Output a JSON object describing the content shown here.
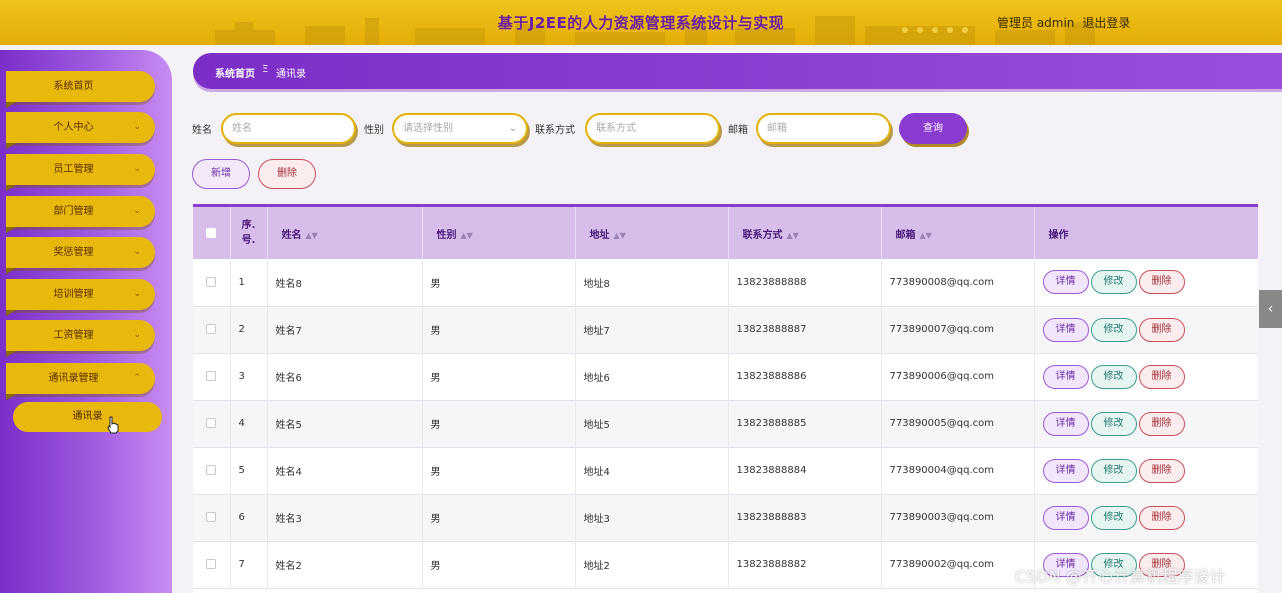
{
  "header": {
    "title": "基于J2EE的人力资源管理系统设计与实现",
    "user_label": "管理员 admin",
    "logout_label": "退出登录"
  },
  "sidebar": {
    "items": [
      {
        "label": "系统首页",
        "chevron": false
      },
      {
        "label": "个人中心",
        "chevron": true
      },
      {
        "label": "员工管理",
        "chevron": true
      },
      {
        "label": "部门管理",
        "chevron": true
      },
      {
        "label": "奖惩管理",
        "chevron": true
      },
      {
        "label": "培训管理",
        "chevron": true
      },
      {
        "label": "工资管理",
        "chevron": true
      },
      {
        "label": "通讯录管理",
        "chevron": true,
        "expanded": true
      }
    ],
    "submenu": {
      "label": "通讯录"
    }
  },
  "breadcrumb": {
    "home": "系统首页",
    "separator": "Ξ",
    "current": "通讯录"
  },
  "search": {
    "name_label": "姓名",
    "name_placeholder": "姓名",
    "gender_label": "性别",
    "gender_placeholder": "请选择性别",
    "contact_label": "联系方式",
    "contact_placeholder": "联系方式",
    "email_label": "邮箱",
    "email_placeholder": "邮箱",
    "query_label": "查询"
  },
  "actions": {
    "add_label": "新增",
    "delete_label": "删除"
  },
  "table": {
    "columns": [
      "序.号.",
      "姓名",
      "性别",
      "地址",
      "联系方式",
      "邮箱",
      "操作"
    ],
    "rows": [
      {
        "no": "1",
        "name": "姓名8",
        "gender": "男",
        "address": "地址8",
        "phone": "13823888888",
        "email": "773890008@qq.com"
      },
      {
        "no": "2",
        "name": "姓名7",
        "gender": "男",
        "address": "地址7",
        "phone": "13823888887",
        "email": "773890007@qq.com"
      },
      {
        "no": "3",
        "name": "姓名6",
        "gender": "男",
        "address": "地址6",
        "phone": "13823888886",
        "email": "773890006@qq.com"
      },
      {
        "no": "4",
        "name": "姓名5",
        "gender": "男",
        "address": "地址5",
        "phone": "13823888885",
        "email": "773890005@qq.com"
      },
      {
        "no": "5",
        "name": "姓名4",
        "gender": "男",
        "address": "地址4",
        "phone": "13823888884",
        "email": "773890004@qq.com"
      },
      {
        "no": "6",
        "name": "姓名3",
        "gender": "男",
        "address": "地址3",
        "phone": "13823888883",
        "email": "773890003@qq.com"
      },
      {
        "no": "7",
        "name": "姓名2",
        "gender": "男",
        "address": "地址2",
        "phone": "13823888882",
        "email": "773890002@qq.com"
      }
    ],
    "ops": {
      "detail": "详情",
      "edit": "修改",
      "delete": "删除"
    }
  },
  "watermark": "CSDN @齐心计算机程序设计",
  "colors": {
    "gold": "#e9b80d",
    "purple": "#8a3bd0",
    "header_purple_text": "#6a1ea6"
  }
}
